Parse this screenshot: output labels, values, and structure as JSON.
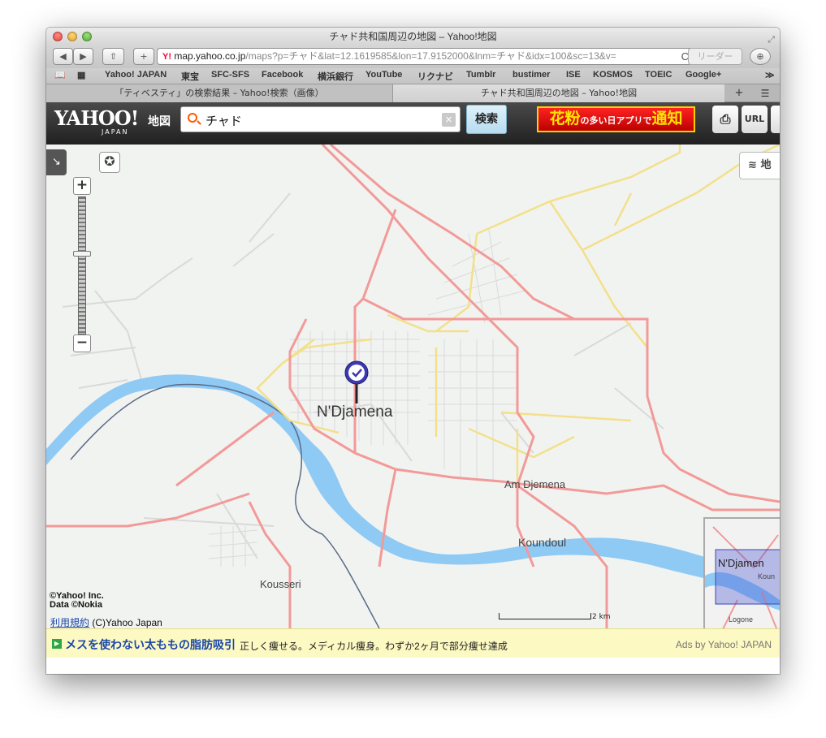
{
  "window": {
    "title": "チャド共和国周辺の地図 – Yahoo!地図"
  },
  "toolbar": {
    "back": "◀",
    "forward": "▶",
    "share": "⇧",
    "new_tab": "+",
    "url_icon": "Y!",
    "url_host": "map.yahoo.co.jp",
    "url_path": "/maps?p=チャド&lat=12.1619585&lon=17.9152000&lnm=チャド&idx=100&sc=13&v=",
    "reload": "C",
    "reader": "リーダー",
    "download": "⊕"
  },
  "bookmarks": {
    "items": [
      "Yahoo! JAPAN",
      "東宝",
      "SFC-SFS",
      "Facebook",
      "横浜銀行",
      "YouTube",
      "リクナビ",
      "Tumblr",
      "bustimer",
      "ISE",
      "KOSMOS",
      "TOEIC",
      "Google+"
    ],
    "more": "≫"
  },
  "tabs": [
    {
      "label": "「ティベスティ」の検索結果 – Yahoo!検索（画像）"
    },
    {
      "label": "チャド共和国周辺の地図 – Yahoo!地図"
    }
  ],
  "header": {
    "logo": "YAHOO!",
    "logo_sub": "JAPAN",
    "service": "地図",
    "search_value": "チャド",
    "clear": "×",
    "search_button": "検索",
    "ad_banner_main": "花粉",
    "ad_banner_small": "の多い日アプリで",
    "ad_banner_end": "通知",
    "print": "⎙",
    "url_button": "URL"
  },
  "map": {
    "layer_button": "地",
    "labels": {
      "city_main": "N'Djamena",
      "am_djemena": "Am Djemena",
      "koundoul": "Koundoul",
      "kousseri": "Kousseri",
      "minimap_city": "N'Djamen",
      "minimap_koun": "Koun",
      "minimap_logone": "Logone"
    },
    "copyright_line1": "©Yahoo! Inc.",
    "copyright_line2": "Data ©Nokia",
    "terms_link": "利用規約",
    "terms_rest": " (C)Yahoo Japan",
    "scale_label": "2 km",
    "zoom_in": "+",
    "zoom_out": "−",
    "zoom_level_fraction": 0.59,
    "icons": {
      "collapse": "collapse-panel-icon",
      "compass": "compass-icon",
      "marker": "location-marker-icon",
      "layers": "layers-icon"
    }
  },
  "adbar": {
    "arrow": "▶",
    "link": "メスを使わない太ももの脂肪吸引",
    "desc": "正しく痩せる。メディカル痩身。わずか2ヶ月で部分痩せ達成",
    "by": "Ads by Yahoo! JAPAN"
  },
  "colors": {
    "river": "#8fcaf5",
    "main_road": "#f29a98",
    "minor_road": "#f3e08a",
    "land": "#f1f3f1"
  }
}
